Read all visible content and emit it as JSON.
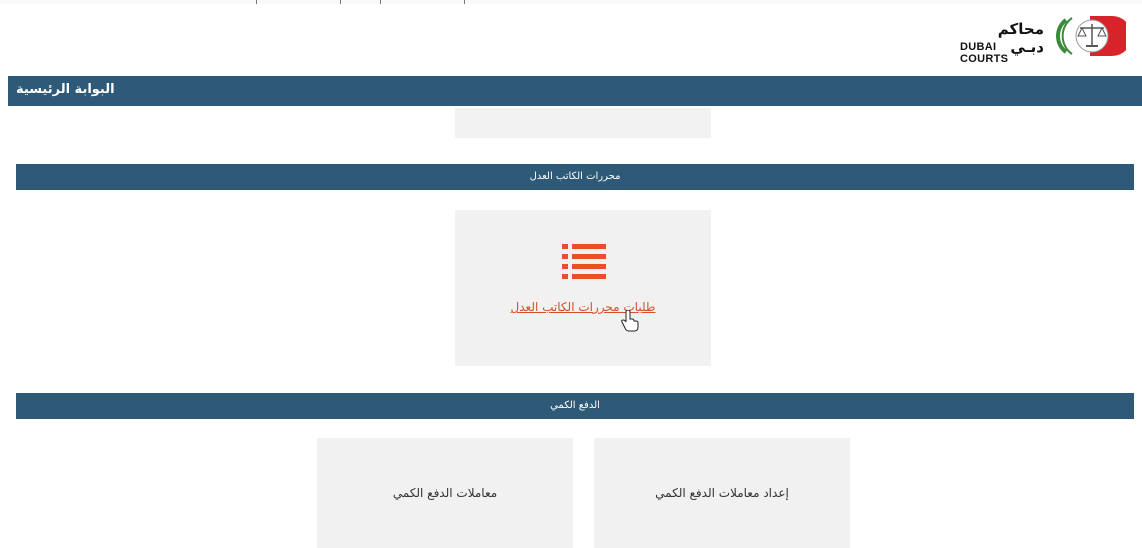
{
  "header": {
    "logo_ar": "محاكم دبـي",
    "logo_en": "DUBAI COURTS"
  },
  "main_bar": {
    "title": "البوابة الرئيسية"
  },
  "sections": [
    {
      "title": "محررات الكاتب العدل",
      "tiles": [
        {
          "label": "طلبات محررات الكاتب العدل",
          "icon": "list-icon",
          "style": "link"
        }
      ]
    },
    {
      "title": "الدفع الكمي",
      "tiles": [
        {
          "label": "إعداد معاملات الدفع الكمي"
        },
        {
          "label": "معاملات الدفع الكمي"
        }
      ]
    }
  ],
  "colors": {
    "bar": "#2e5a78",
    "tile_bg": "#f1f1f1",
    "accent": "#e8502a",
    "link": "#d4502a"
  }
}
